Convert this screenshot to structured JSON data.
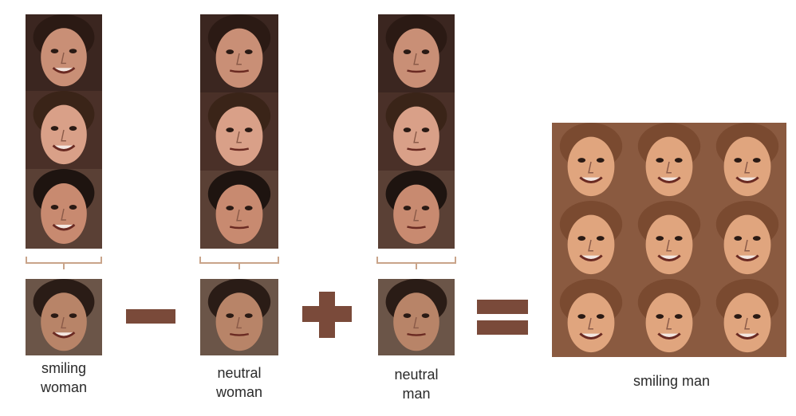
{
  "columns": [
    {
      "label_line1": "smiling",
      "label_line2": "woman"
    },
    {
      "label_line1": "neutral",
      "label_line2": "woman"
    },
    {
      "label_line1": "neutral",
      "label_line2": "man"
    }
  ],
  "result": {
    "label": "smiling man"
  },
  "operators": [
    "minus",
    "plus",
    "equals"
  ],
  "colors": {
    "operator": "#7a4a3a",
    "brace": "#c9a48a"
  }
}
